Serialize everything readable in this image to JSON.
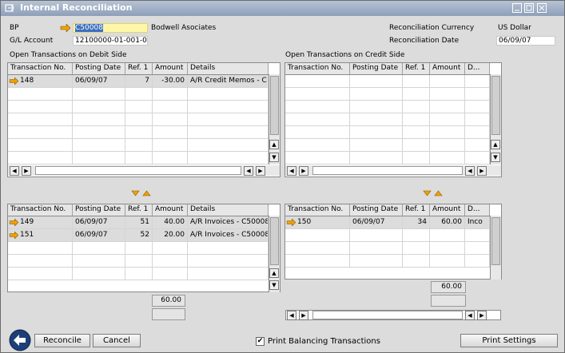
{
  "window": {
    "title": "Internal Reconciliation"
  },
  "header": {
    "bp_label": "BP",
    "bp_code": "C50008",
    "bp_name": "Bodwell Asociates",
    "gl_label": "G/L Account",
    "gl_value": "12100000-01-001-01",
    "currency_label": "Reconciliation Currency",
    "currency_value": "US Dollar",
    "date_label": "Reconciliation Date",
    "date_value": "06/09/07"
  },
  "debit": {
    "title": "Open Transactions on Debit Side",
    "columns": [
      "Transaction No.",
      "Posting Date",
      "Ref. 1",
      "Amount",
      "Details"
    ],
    "rows": [
      {
        "trans": "148",
        "date": "06/09/07",
        "ref": "7",
        "amount": "-30.00",
        "details": "A/R Credit Memos - C"
      }
    ]
  },
  "credit": {
    "title": "Open Transactions on Credit Side",
    "columns": [
      "Transaction No.",
      "Posting Date",
      "Ref. 1",
      "Amount",
      "D..."
    ],
    "rows": []
  },
  "debit_selected": {
    "columns": [
      "Transaction No.",
      "Posting Date",
      "Ref. 1",
      "Amount",
      "Details"
    ],
    "rows": [
      {
        "trans": "149",
        "date": "06/09/07",
        "ref": "51",
        "amount": "40.00",
        "details": "A/R Invoices - C50008"
      },
      {
        "trans": "151",
        "date": "06/09/07",
        "ref": "52",
        "amount": "20.00",
        "details": "A/R Invoices - C50008"
      }
    ],
    "total": "60.00"
  },
  "credit_selected": {
    "columns": [
      "Transaction No.",
      "Posting Date",
      "Ref. 1",
      "Amount",
      "D..."
    ],
    "rows": [
      {
        "trans": "150",
        "date": "06/09/07",
        "ref": "34",
        "amount": "60.00",
        "details": "Inco"
      }
    ],
    "total": "60.00"
  },
  "footer": {
    "reconcile": "Reconcile",
    "cancel": "Cancel",
    "print_balancing": "Print Balancing Transactions",
    "print_balancing_checked": true,
    "print_settings": "Print Settings"
  },
  "colors": {
    "accent": "#f0a000",
    "title_bar": "#8d9fb9"
  }
}
